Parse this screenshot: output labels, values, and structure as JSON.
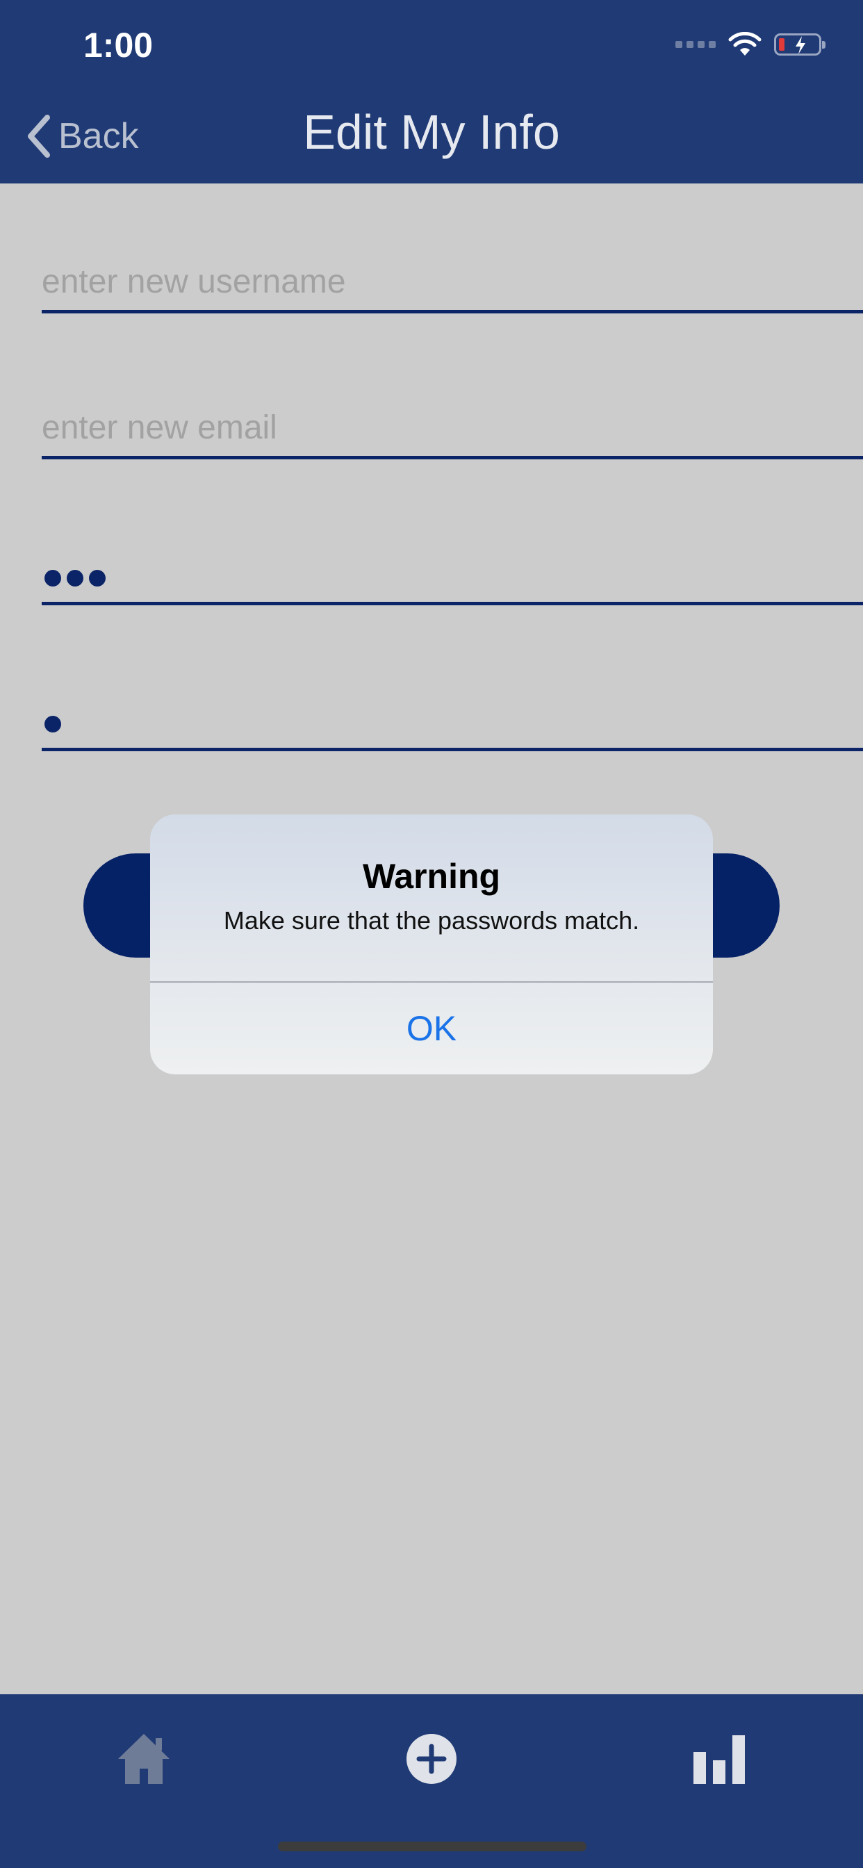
{
  "status_bar": {
    "time": "1:00",
    "icons": [
      "cellular-signal-icon",
      "wifi-icon",
      "battery-charging-icon"
    ]
  },
  "nav": {
    "back_label": "Back",
    "title": "Edit My Info"
  },
  "form": {
    "username": {
      "placeholder": "enter new username",
      "value": ""
    },
    "email": {
      "placeholder": "enter new email",
      "value": ""
    },
    "password": {
      "masked_length": 3
    },
    "confirm_password": {
      "masked_length": 1
    }
  },
  "alert": {
    "title": "Warning",
    "message": "Make sure that the passwords match.",
    "ok_label": "OK"
  },
  "tabbar": {
    "items": [
      "home-icon",
      "add-circle-icon",
      "bar-chart-icon"
    ]
  },
  "colors": {
    "header_bg": "#1f3a75",
    "accent_dark": "#0b2468",
    "button_bg": "#062267",
    "alert_action": "#1a73e8",
    "background": "#cccccc"
  }
}
